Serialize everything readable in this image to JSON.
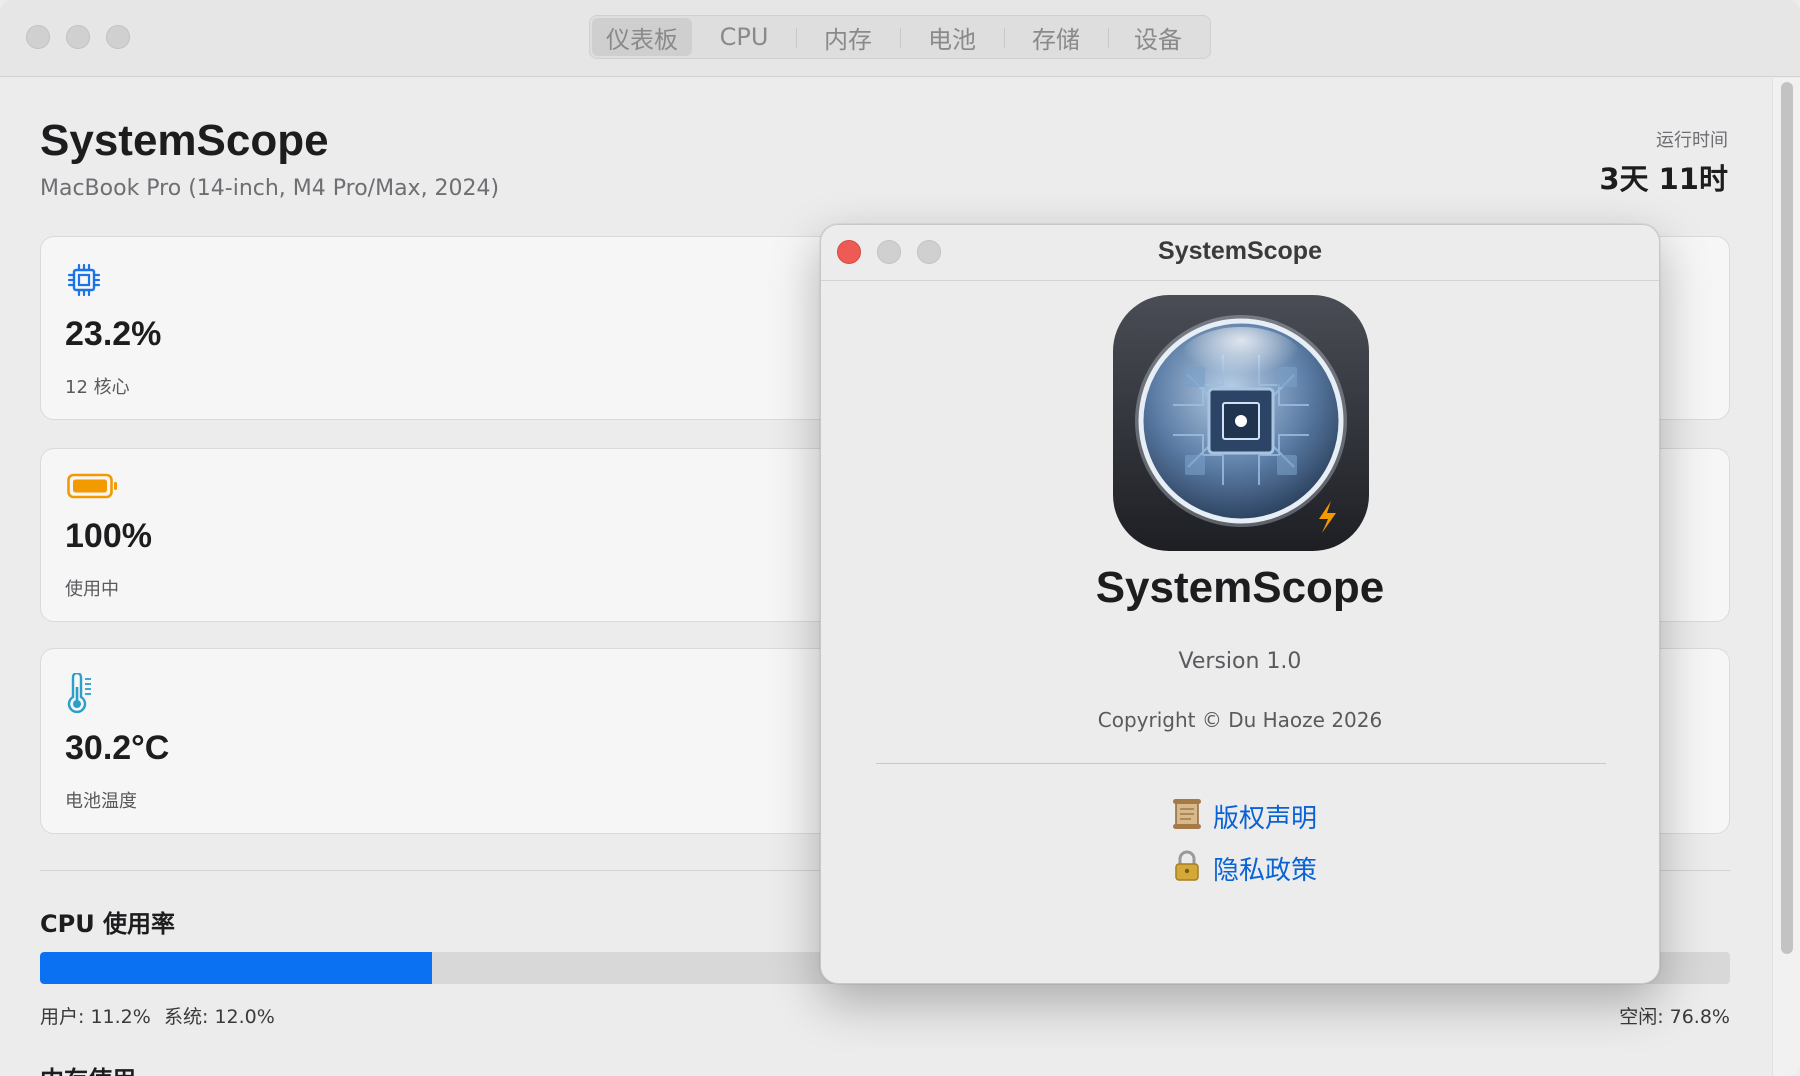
{
  "toolbar": {
    "tabs": [
      {
        "label": "仪表板",
        "active": true
      },
      {
        "label": "CPU",
        "active": false
      },
      {
        "label": "内存",
        "active": false
      },
      {
        "label": "电池",
        "active": false
      },
      {
        "label": "存储",
        "active": false
      },
      {
        "label": "设备",
        "active": false
      }
    ]
  },
  "header": {
    "title": "SystemScope",
    "device": "MacBook Pro (14-inch, M4 Pro/Max, 2024)",
    "uptime_label": "运行时间",
    "uptime_value": "3天 11时"
  },
  "cards": [
    {
      "icon": "cpu-chip-icon",
      "value": "23.2%",
      "sub": "12 核心",
      "color": "#1a73e8"
    },
    {
      "icon": "battery-icon",
      "value": "100%",
      "sub": "使用中",
      "color": "#f39a00",
      "level": 100
    },
    {
      "icon": "thermometer-icon",
      "value": "30.2°C",
      "sub": "电池温度",
      "color": "#2a9fc9"
    }
  ],
  "cpu_usage": {
    "title": "CPU 使用率",
    "fill_percent": 23.2,
    "user": "用户: 11.2%",
    "system": "系统: 12.0%",
    "idle": "空闲: 76.8%",
    "fill_color": "#0a72f2"
  },
  "memory": {
    "title": "内存使用"
  },
  "about": {
    "window_title": "SystemScope",
    "app_name": "SystemScope",
    "version": "Version 1.0",
    "copyright": "Copyright © Du Haoze 2026",
    "links": [
      {
        "icon": "scroll-icon",
        "label": "版权声明"
      },
      {
        "icon": "lock-icon",
        "label": "隐私政策"
      }
    ],
    "link_color": "#0a63d6",
    "close_color": "#ee5b55"
  }
}
